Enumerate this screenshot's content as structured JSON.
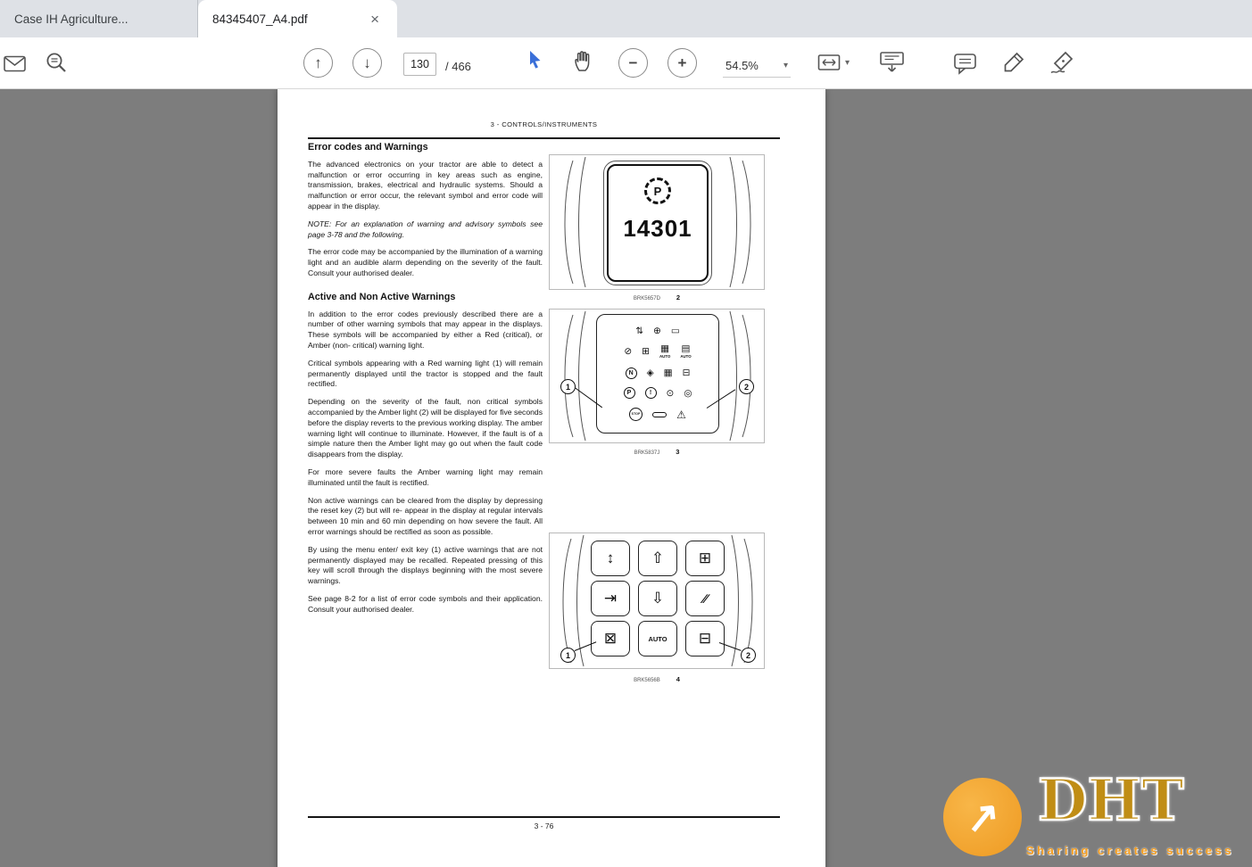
{
  "browser": {
    "tabs": [
      {
        "title": "Case IH Agriculture..."
      },
      {
        "title": "84345407_A4.pdf",
        "close": "×"
      }
    ]
  },
  "toolbar": {
    "page_current": "130",
    "page_total": "/ 466",
    "zoom_level": "54.5%",
    "caret": "▾"
  },
  "doc": {
    "header": "3 - CONTROLS/INSTRUMENTS",
    "footer": "3 - 76",
    "s1_title": "Error codes and Warnings",
    "s1_p1": "The advanced electronics on your tractor are able to detect a malfunction or error occurring in key areas such as engine, transmission, brakes, electrical and hydraulic systems. Should a malfunction or error occur, the relevant symbol and error code will appear in the display.",
    "s1_note": "NOTE: For an explanation of warning and advisory symbols see page 3-78 and the following.",
    "s1_p2": "The error code may be accompanied by the illumination of a warning light and an audible alarm depending on the severity of the fault. Consult your authorised dealer.",
    "s2_title": "Active and Non Active Warnings",
    "s2_p1": "In addition to the error codes previously described there are a number of other warning symbols that may appear in the displays. These symbols will be accompanied by either a Red (critical), or Amber (non- critical) warning light.",
    "s2_p2": "Critical symbols appearing with a Red warning light (1) will remain permanently displayed until the tractor is stopped and the fault rectified.",
    "s2_p3": "Depending on the severity of the fault, non critical symbols accompanied by the Amber light (2) will be displayed for five seconds before the display reverts to the previous working display. The amber warning light will continue to illuminate. However, if the fault is of a simple nature then the Amber light may go out when the fault code disappears from the display.",
    "s2_p4": "For more severe faults the Amber warning light may remain illuminated until the fault is rectified.",
    "s2_p5": "Non active warnings can be cleared from the display by depressing the reset key (2) but will re- appear in the display at regular intervals between 10 min and 60 min depending on how severe the fault. All error warnings should be rectified as soon as possible.",
    "s2_p6": "By using the menu enter/ exit key (1) active warnings that are not permanently displayed may be recalled. Repeated pressing of this key will scroll through the displays beginning with the most severe warnings.",
    "s2_p7": "See page 8-2 for a list of error code symbols and their application. Consult your authorised dealer.",
    "fig2": {
      "gear_letter": "P",
      "display_value": "14301",
      "code": "BRK5657D",
      "num": "2"
    },
    "fig3": {
      "code": "BRK5837J",
      "num": "3",
      "callout1": "1",
      "callout2": "2",
      "rows1": [
        "⇅",
        "⊕",
        "▭"
      ],
      "rows2": [
        "⊘",
        "⊞",
        "▦",
        "▤"
      ],
      "auto": "AUTO",
      "rows3": [
        "N",
        "◈",
        "▦",
        "⊟"
      ],
      "rows4": [
        "P",
        "!",
        "⊙",
        "◎"
      ],
      "stop": "STOP",
      "warn": "⚠"
    },
    "fig4": {
      "code": "BRK5656B",
      "num": "4",
      "callout1": "1",
      "callout2": "2",
      "keys": [
        "↕",
        "⇧",
        "⊞",
        "⇥",
        "⇩",
        "∕∕",
        "⊠",
        "AUTO",
        "⊟"
      ]
    }
  },
  "watermark": {
    "arrow": "↗",
    "title": "DHT",
    "subtitle": "Sharing creates success"
  }
}
